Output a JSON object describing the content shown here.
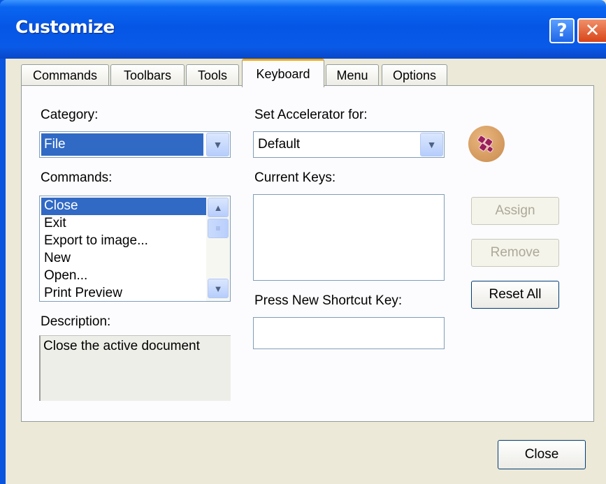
{
  "window": {
    "title": "Customize",
    "help_symbol": "?",
    "close_symbol": "✕"
  },
  "tabs": [
    {
      "label": "Commands"
    },
    {
      "label": "Toolbars"
    },
    {
      "label": "Tools"
    },
    {
      "label": "Keyboard",
      "active": true
    },
    {
      "label": "Menu"
    },
    {
      "label": "Options"
    }
  ],
  "keyboard": {
    "category_label": "Category:",
    "category_value": "File",
    "commands_label": "Commands:",
    "commands": [
      "Close",
      "Exit",
      "Export to image...",
      "New",
      "Open...",
      "Print Preview"
    ],
    "selected_command": "Close",
    "description_label": "Description:",
    "description_text": "Close the active document",
    "set_accel_label": "Set Accelerator for:",
    "set_accel_value": "Default",
    "current_keys_label": "Current Keys:",
    "press_new_label": "Press New Shortcut Key:",
    "assign_label": "Assign",
    "remove_label": "Remove",
    "reset_all_label": "Reset All"
  },
  "footer": {
    "close_label": "Close"
  },
  "icons": {
    "app_icon": "app-logo-icon",
    "dropdown": "chevron-down-icon",
    "scroll_up": "chevron-up-icon",
    "scroll_down": "chevron-down-icon"
  },
  "colors": {
    "title_bar": "#0a5ae8",
    "selection": "#316ac5",
    "active_tab_accent": "#f5a80f",
    "dialog_bg": "#ece9d8"
  }
}
